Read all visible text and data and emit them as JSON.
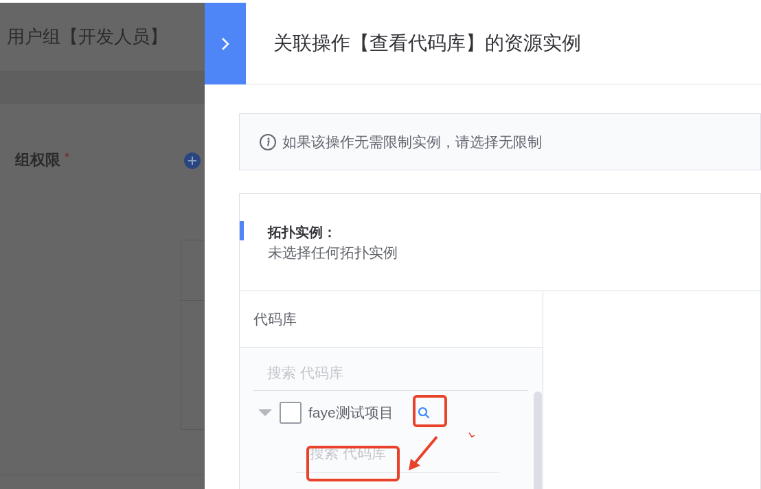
{
  "background": {
    "title": "用户组【开发人员】",
    "section_label": "组权限",
    "required_mark": "*"
  },
  "drawer": {
    "title": "关联操作【查看代码库】的资源实例",
    "notice": "如果该操作无需限制实例，请选择无限制",
    "topology": {
      "label": "拓扑实例：",
      "value": "未选择任何拓扑实例"
    },
    "resource": {
      "header": "代码库",
      "search": {
        "placeholder": "搜索 代码库"
      },
      "tree": [
        {
          "label": "faye测试项目",
          "expanded": true,
          "checked": false,
          "search": {
            "placeholder": "搜索 代码库"
          }
        }
      ]
    }
  }
}
